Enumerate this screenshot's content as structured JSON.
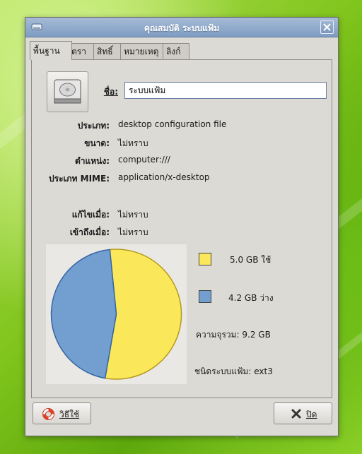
{
  "window": {
    "title": "คุณสมบัติ ระบบแฟ้ม"
  },
  "tabs": [
    {
      "label": "พื้นฐาน",
      "active": true
    },
    {
      "label": "ตรา",
      "active": false
    },
    {
      "label": "สิทธิ์",
      "active": false
    },
    {
      "label": "หมายเหตุ",
      "active": false
    },
    {
      "label": "ลิงก์",
      "active": false
    }
  ],
  "basic": {
    "icon": "harddrive-icon",
    "name_label": "ชื่อ:",
    "name_value": "ระบบแฟ้ม",
    "fields": [
      {
        "label": "ประเภท:",
        "value": "desktop configuration file"
      },
      {
        "label": "ขนาด:",
        "value": "ไม่ทราบ"
      },
      {
        "label": "ตำแหน่ง:",
        "value": "computer:///"
      },
      {
        "label": "ประเภท MIME:",
        "value": "application/x-desktop"
      },
      {
        "label": "แก้ไขเมื่อ:",
        "value": "ไม่ทราบ"
      },
      {
        "label": "เข้าถึงเมื่อ:",
        "value": "ไม่ทราบ"
      }
    ]
  },
  "usage": {
    "used_label": "5.0 GB ใช้",
    "free_label": "4.2 GB ว่าง",
    "capacity_text": "ความจุรวม:  9.2 GB",
    "fs_text": "ชนิดระบบแฟ้ม:  ext3",
    "used_gb": 5.0,
    "free_gb": 4.2,
    "used_color": "#fbe85a",
    "free_color": "#729fcf"
  },
  "buttons": {
    "help_label": "วิธีใช้",
    "close_label": "ปิด"
  }
}
